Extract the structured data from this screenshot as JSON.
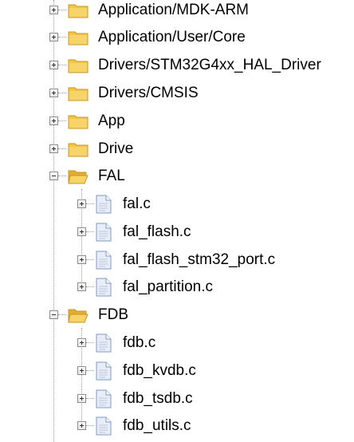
{
  "tree": {
    "groups": [
      {
        "label": "Application/MDK-ARM",
        "expanded": false
      },
      {
        "label": "Application/User/Core",
        "expanded": false
      },
      {
        "label": "Drivers/STM32G4xx_HAL_Driver",
        "expanded": false
      },
      {
        "label": "Drivers/CMSIS",
        "expanded": false
      },
      {
        "label": "App",
        "expanded": false
      },
      {
        "label": "Drive",
        "expanded": false
      },
      {
        "label": "FAL",
        "expanded": true,
        "files": [
          "fal.c",
          "fal_flash.c",
          "fal_flash_stm32_port.c",
          "fal_partition.c"
        ]
      },
      {
        "label": "FDB",
        "expanded": true,
        "files": [
          "fdb.c",
          "fdb_kvdb.c",
          "fdb_tsdb.c",
          "fdb_utils.c"
        ]
      }
    ]
  },
  "icons": {
    "folder_closed": "folder-icon",
    "folder_open": "folder-open-icon",
    "file": "c-source-file-icon",
    "collapsed": "expand-plus-icon",
    "expanded": "collapse-minus-icon"
  },
  "colors": {
    "folder_body": "#f3c54a",
    "folder_edge": "#c8961e",
    "file_body": "#e8eef8",
    "file_edge": "#7f9bc4",
    "connector": "#9a9a9a"
  }
}
